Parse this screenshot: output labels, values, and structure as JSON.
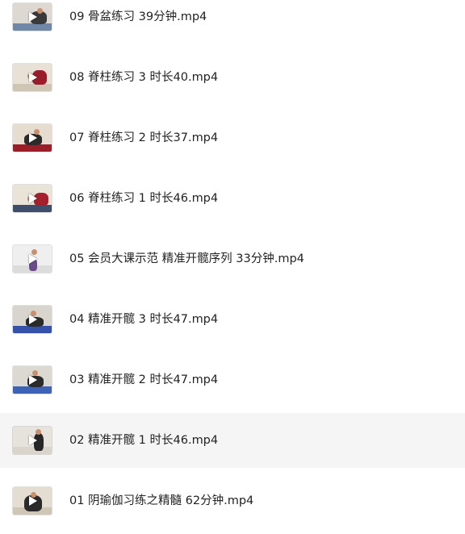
{
  "files": [
    {
      "name": "09 骨盆练习 39分钟.mp4",
      "thumb_bg": "#ddd9d2",
      "floor": "#6f88a8",
      "figure": "#3a3a3a",
      "skin": "#c98f6e"
    },
    {
      "name": "08 脊柱练习 3 时长40.mp4",
      "thumb_bg": "#e8e2d6",
      "floor": "#cfc5b4",
      "figure": "#9b1d2a",
      "skin": "#c98f6e"
    },
    {
      "name": "07 脊柱练习 2 时长37.mp4",
      "thumb_bg": "#e6ddd0",
      "floor": "#9b1d2a",
      "figure": "#2b2b2b",
      "skin": "#c98f6e"
    },
    {
      "name": "06 脊柱练习 1 时长46.mp4",
      "thumb_bg": "#e9e3d8",
      "floor": "#3e4d6b",
      "figure": "#a3202c",
      "skin": "#c98f6e"
    },
    {
      "name": "05 会员大课示范 精准开髋序列 33分钟.mp4",
      "thumb_bg": "#f0efef",
      "floor": "#dcdcdc",
      "figure": "#6b4c8a",
      "skin": "#c98f6e"
    },
    {
      "name": "04 精准开髋 3 时长47.mp4",
      "thumb_bg": "#d8d5cf",
      "floor": "#3552a8",
      "figure": "#2b2b2b",
      "skin": "#c98f6e"
    },
    {
      "name": "03 精准开髋 2 时长47.mp4",
      "thumb_bg": "#dcd9d3",
      "floor": "#3e62b5",
      "figure": "#2b2b2b",
      "skin": "#c98f6e"
    },
    {
      "name": "02 精准开髋 1 时长46.mp4",
      "thumb_bg": "#e6e3dc",
      "floor": "#d9d5cc",
      "figure": "#262626",
      "skin": "#c98f6e"
    },
    {
      "name": "01 阴瑜伽习练之精髓 62分钟.mp4",
      "thumb_bg": "#e3ddd2",
      "floor": "#cfc6b6",
      "figure": "#2a2a2a",
      "skin": "#c98f6e"
    }
  ],
  "selected_index": 7,
  "colors": {
    "text": "#222222",
    "selected_row_bg": "#f5f5f5",
    "background": "#ffffff"
  },
  "icons": {
    "play": "play-icon"
  }
}
